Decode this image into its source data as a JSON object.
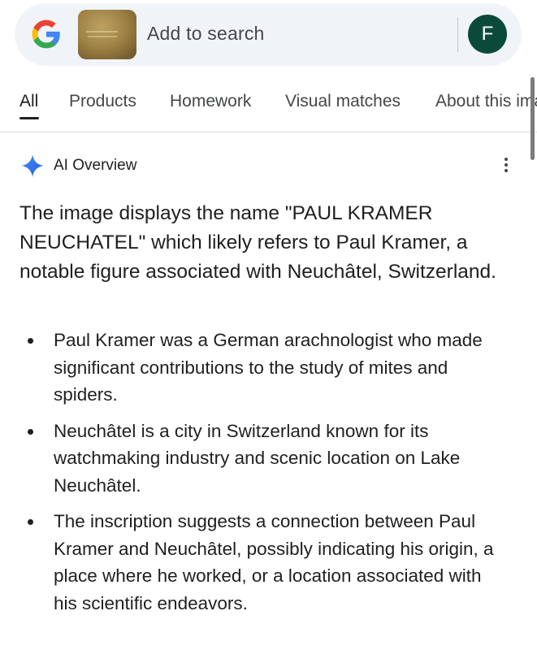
{
  "search_bar": {
    "placeholder": "Add to search",
    "thumbnail_text": "PAUL KRAMER NEUCHATEL",
    "avatar_initial": "F",
    "logo_icon": "google-g-icon"
  },
  "tabs": [
    {
      "label": "All",
      "active": true
    },
    {
      "label": "Products",
      "active": false
    },
    {
      "label": "Homework",
      "active": false
    },
    {
      "label": "Visual matches",
      "active": false
    },
    {
      "label": "About this image",
      "active": false
    }
  ],
  "ai_overview": {
    "icon": "sparkle-icon",
    "title": "AI Overview",
    "menu_icon": "more-vert-icon",
    "intro": "The image displays the name \"PAUL KRAMER NEUCHATEL\" which likely refers to Paul Kramer, a notable figure associated with Neuchâtel, Switzerland.",
    "bullets": [
      "Paul Kramer was a German arachnologist who made significant contributions to the study of mites and spiders.",
      "Neuchâtel is a city in Switzerland known for its watchmaking industry and scenic location on Lake Neuchâtel.",
      "The inscription suggests a connection between Paul Kramer and Neuchâtel, possibly indicating his origin, a place where he worked, or a location associated with his scientific endeavors."
    ]
  },
  "colors": {
    "search_bg": "#f0f4f9",
    "avatar_bg": "#0b4a3a",
    "text_primary": "#1f1f1f",
    "text_secondary": "#444746",
    "thumbnail_gold": "#a88a4a"
  }
}
